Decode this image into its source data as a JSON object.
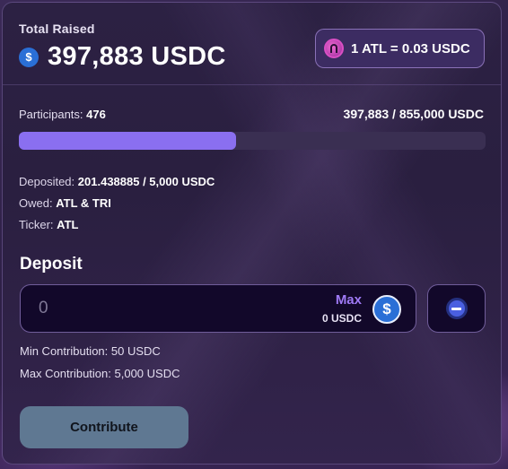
{
  "summary": {
    "total_label": "Total Raised",
    "total_value": "397,883 USDC",
    "rate": "1 ATL = 0.03 USDC"
  },
  "progress": {
    "participants_label": "Participants:",
    "participants_value": "476",
    "raised_text": "397,883 / 855,000 USDC",
    "fraction": 0.465
  },
  "details": {
    "deposited_label": "Deposited:",
    "deposited_value": "201.438885 / 5,000 USDC",
    "owed_label": "Owed:",
    "owed_value": "ATL & TRI",
    "ticker_label": "Ticker:",
    "ticker_value": "ATL"
  },
  "deposit": {
    "heading": "Deposit",
    "input_value": "0",
    "max_label": "Max",
    "balance": "0 USDC",
    "min_contribution": "Min Contribution: 50 USDC",
    "max_contribution": "Max Contribution: 5,000 USDC",
    "contribute_label": "Contribute"
  },
  "icons": {
    "usdc": "usdc-icon",
    "atl": "atl-token-icon",
    "toggle": "minus-circle-icon"
  },
  "colors": {
    "accent": "#8a6ff0",
    "max_link": "#9f7af5",
    "contribute_button": "#5f7892"
  }
}
